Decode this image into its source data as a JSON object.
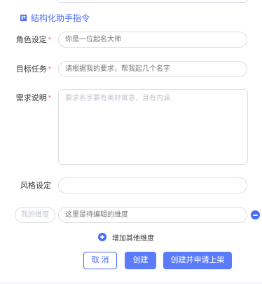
{
  "section": {
    "title": "结构化助手指令",
    "icon": "book-icon",
    "accent_color": "#4a6cf7"
  },
  "fields": {
    "role": {
      "label": "角色设定",
      "required_mark": "*",
      "placeholder": "你是一位起名大师",
      "value": ""
    },
    "goal": {
      "label": "目标任务",
      "required_mark": "*",
      "placeholder": "请根据我的要求，帮我起几个名字",
      "value": ""
    },
    "requirement": {
      "label": "需求说明",
      "required_mark": "*",
      "placeholder": "要求名字要有美好寓意，且有内涵",
      "value": ""
    },
    "style": {
      "label": "风格设定",
      "placeholder": "",
      "value": ""
    }
  },
  "custom_dimension": {
    "name_placeholder": "我的维度",
    "value_placeholder": "这里是待编辑的维度"
  },
  "add_dimension_label": "增加其他维度",
  "buttons": {
    "cancel": "取 消",
    "create": "创建",
    "create_publish": "创建并申请上架"
  }
}
